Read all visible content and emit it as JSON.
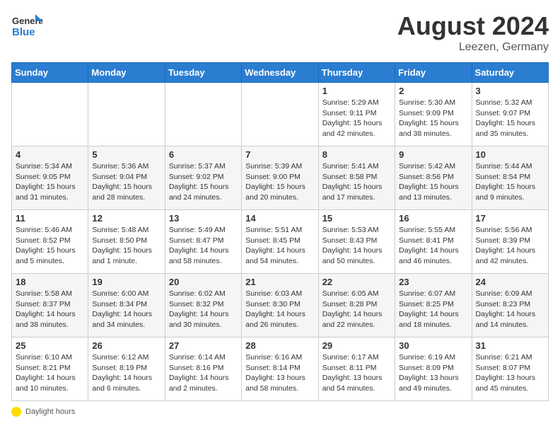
{
  "header": {
    "logo": {
      "line1": "General",
      "line2": "Blue"
    },
    "month": "August 2024",
    "location": "Leezen, Germany"
  },
  "weekdays": [
    "Sunday",
    "Monday",
    "Tuesday",
    "Wednesday",
    "Thursday",
    "Friday",
    "Saturday"
  ],
  "weeks": [
    [
      {
        "day": "",
        "sunrise": "",
        "sunset": "",
        "daylight": ""
      },
      {
        "day": "",
        "sunrise": "",
        "sunset": "",
        "daylight": ""
      },
      {
        "day": "",
        "sunrise": "",
        "sunset": "",
        "daylight": ""
      },
      {
        "day": "",
        "sunrise": "",
        "sunset": "",
        "daylight": ""
      },
      {
        "day": "1",
        "sunrise": "5:29 AM",
        "sunset": "9:11 PM",
        "daylight": "15 hours and 42 minutes."
      },
      {
        "day": "2",
        "sunrise": "5:30 AM",
        "sunset": "9:09 PM",
        "daylight": "15 hours and 38 minutes."
      },
      {
        "day": "3",
        "sunrise": "5:32 AM",
        "sunset": "9:07 PM",
        "daylight": "15 hours and 35 minutes."
      }
    ],
    [
      {
        "day": "4",
        "sunrise": "5:34 AM",
        "sunset": "9:05 PM",
        "daylight": "15 hours and 31 minutes."
      },
      {
        "day": "5",
        "sunrise": "5:36 AM",
        "sunset": "9:04 PM",
        "daylight": "15 hours and 28 minutes."
      },
      {
        "day": "6",
        "sunrise": "5:37 AM",
        "sunset": "9:02 PM",
        "daylight": "15 hours and 24 minutes."
      },
      {
        "day": "7",
        "sunrise": "5:39 AM",
        "sunset": "9:00 PM",
        "daylight": "15 hours and 20 minutes."
      },
      {
        "day": "8",
        "sunrise": "5:41 AM",
        "sunset": "8:58 PM",
        "daylight": "15 hours and 17 minutes."
      },
      {
        "day": "9",
        "sunrise": "5:42 AM",
        "sunset": "8:56 PM",
        "daylight": "15 hours and 13 minutes."
      },
      {
        "day": "10",
        "sunrise": "5:44 AM",
        "sunset": "8:54 PM",
        "daylight": "15 hours and 9 minutes."
      }
    ],
    [
      {
        "day": "11",
        "sunrise": "5:46 AM",
        "sunset": "8:52 PM",
        "daylight": "15 hours and 5 minutes."
      },
      {
        "day": "12",
        "sunrise": "5:48 AM",
        "sunset": "8:50 PM",
        "daylight": "15 hours and 1 minute."
      },
      {
        "day": "13",
        "sunrise": "5:49 AM",
        "sunset": "8:47 PM",
        "daylight": "14 hours and 58 minutes."
      },
      {
        "day": "14",
        "sunrise": "5:51 AM",
        "sunset": "8:45 PM",
        "daylight": "14 hours and 54 minutes."
      },
      {
        "day": "15",
        "sunrise": "5:53 AM",
        "sunset": "8:43 PM",
        "daylight": "14 hours and 50 minutes."
      },
      {
        "day": "16",
        "sunrise": "5:55 AM",
        "sunset": "8:41 PM",
        "daylight": "14 hours and 46 minutes."
      },
      {
        "day": "17",
        "sunrise": "5:56 AM",
        "sunset": "8:39 PM",
        "daylight": "14 hours and 42 minutes."
      }
    ],
    [
      {
        "day": "18",
        "sunrise": "5:58 AM",
        "sunset": "8:37 PM",
        "daylight": "14 hours and 38 minutes."
      },
      {
        "day": "19",
        "sunrise": "6:00 AM",
        "sunset": "8:34 PM",
        "daylight": "14 hours and 34 minutes."
      },
      {
        "day": "20",
        "sunrise": "6:02 AM",
        "sunset": "8:32 PM",
        "daylight": "14 hours and 30 minutes."
      },
      {
        "day": "21",
        "sunrise": "6:03 AM",
        "sunset": "8:30 PM",
        "daylight": "14 hours and 26 minutes."
      },
      {
        "day": "22",
        "sunrise": "6:05 AM",
        "sunset": "8:28 PM",
        "daylight": "14 hours and 22 minutes."
      },
      {
        "day": "23",
        "sunrise": "6:07 AM",
        "sunset": "8:25 PM",
        "daylight": "14 hours and 18 minutes."
      },
      {
        "day": "24",
        "sunrise": "6:09 AM",
        "sunset": "8:23 PM",
        "daylight": "14 hours and 14 minutes."
      }
    ],
    [
      {
        "day": "25",
        "sunrise": "6:10 AM",
        "sunset": "8:21 PM",
        "daylight": "14 hours and 10 minutes."
      },
      {
        "day": "26",
        "sunrise": "6:12 AM",
        "sunset": "8:19 PM",
        "daylight": "14 hours and 6 minutes."
      },
      {
        "day": "27",
        "sunrise": "6:14 AM",
        "sunset": "8:16 PM",
        "daylight": "14 hours and 2 minutes."
      },
      {
        "day": "28",
        "sunrise": "6:16 AM",
        "sunset": "8:14 PM",
        "daylight": "13 hours and 58 minutes."
      },
      {
        "day": "29",
        "sunrise": "6:17 AM",
        "sunset": "8:11 PM",
        "daylight": "13 hours and 54 minutes."
      },
      {
        "day": "30",
        "sunrise": "6:19 AM",
        "sunset": "8:09 PM",
        "daylight": "13 hours and 49 minutes."
      },
      {
        "day": "31",
        "sunrise": "6:21 AM",
        "sunset": "8:07 PM",
        "daylight": "13 hours and 45 minutes."
      }
    ]
  ],
  "footer": {
    "legend": "Daylight hours"
  }
}
